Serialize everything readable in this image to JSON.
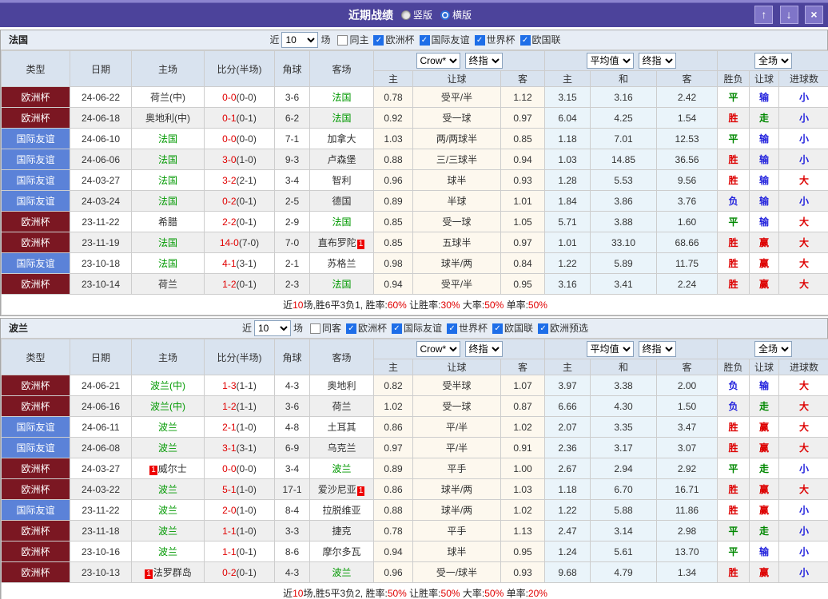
{
  "titlebar": {
    "title": "近期战绩",
    "layout_options": [
      {
        "label": "竖版",
        "selected": false
      },
      {
        "label": "横版",
        "selected": true
      }
    ],
    "buttons": {
      "up": "↑",
      "down": "↓",
      "close": "×"
    }
  },
  "table_header": {
    "type": "类型",
    "date": "日期",
    "home": "主场",
    "score": "比分(半场)",
    "corner": "角球",
    "away": "客场",
    "crow_select": "Crow*",
    "crow_index_select": "终指",
    "avg_select": "平均值",
    "avg_index_select": "终指",
    "scope_select": "全场",
    "odds_home": "主",
    "odds_handicap": "让球",
    "odds_away": "客",
    "avg_home": "主",
    "avg_draw": "和",
    "avg_away": "客",
    "result_wl": "胜负",
    "result_handicap": "让球",
    "result_goals": "进球数"
  },
  "colors": {
    "titlebar": "#4c439b",
    "euro_cup_bg": "#7b1722",
    "friendly_bg": "#5b82d8",
    "win_red": "#dd0000",
    "draw_green": "#008800",
    "lose_blue": "#2323dd",
    "team_green": "#009900",
    "score_red": "#e00000"
  },
  "sections": [
    {
      "team": "法国",
      "filter": {
        "near": "近",
        "count": "10",
        "games": "场",
        "same": {
          "label": "同主",
          "checked": false
        },
        "leagues": [
          {
            "label": "欧洲杯",
            "checked": true
          },
          {
            "label": "国际友谊",
            "checked": true
          },
          {
            "label": "世界杯",
            "checked": true
          },
          {
            "label": "欧国联",
            "checked": true
          }
        ]
      },
      "rows": [
        {
          "type": "欧洲杯",
          "date": "24-06-22",
          "home": "荷兰(中)",
          "hg": false,
          "hb": "",
          "score": "0-0",
          "half": "(0-0)",
          "corner": "3-6",
          "away": "法国",
          "ag": true,
          "ab": "",
          "o1": "0.78",
          "line": "受平/半",
          "o2": "1.12",
          "m1": "3.15",
          "m2": "3.16",
          "m3": "2.42",
          "r1": "平",
          "r2": "输",
          "r3": "小"
        },
        {
          "type": "欧洲杯",
          "date": "24-06-18",
          "home": "奥地利(中)",
          "hg": false,
          "hb": "",
          "score": "0-1",
          "half": "(0-1)",
          "corner": "6-2",
          "away": "法国",
          "ag": true,
          "ab": "",
          "o1": "0.92",
          "line": "受一球",
          "o2": "0.97",
          "m1": "6.04",
          "m2": "4.25",
          "m3": "1.54",
          "r1": "胜",
          "r2": "走",
          "r3": "小"
        },
        {
          "type": "国际友谊",
          "date": "24-06-10",
          "home": "法国",
          "hg": true,
          "hb": "",
          "score": "0-0",
          "half": "(0-0)",
          "corner": "7-1",
          "away": "加拿大",
          "ag": false,
          "ab": "",
          "o1": "1.03",
          "line": "两/两球半",
          "o2": "0.85",
          "m1": "1.18",
          "m2": "7.01",
          "m3": "12.53",
          "r1": "平",
          "r2": "输",
          "r3": "小"
        },
        {
          "type": "国际友谊",
          "date": "24-06-06",
          "home": "法国",
          "hg": true,
          "hb": "",
          "score": "3-0",
          "half": "(1-0)",
          "corner": "9-3",
          "away": "卢森堡",
          "ag": false,
          "ab": "",
          "o1": "0.88",
          "line": "三/三球半",
          "o2": "0.94",
          "m1": "1.03",
          "m2": "14.85",
          "m3": "36.56",
          "r1": "胜",
          "r2": "输",
          "r3": "小"
        },
        {
          "type": "国际友谊",
          "date": "24-03-27",
          "home": "法国",
          "hg": true,
          "hb": "",
          "score": "3-2",
          "half": "(2-1)",
          "corner": "3-4",
          "away": "智利",
          "ag": false,
          "ab": "",
          "o1": "0.96",
          "line": "球半",
          "o2": "0.93",
          "m1": "1.28",
          "m2": "5.53",
          "m3": "9.56",
          "r1": "胜",
          "r2": "输",
          "r3": "大"
        },
        {
          "type": "国际友谊",
          "date": "24-03-24",
          "home": "法国",
          "hg": true,
          "hb": "",
          "score": "0-2",
          "half": "(0-1)",
          "corner": "2-5",
          "away": "德国",
          "ag": false,
          "ab": "",
          "o1": "0.89",
          "line": "半球",
          "o2": "1.01",
          "m1": "1.84",
          "m2": "3.86",
          "m3": "3.76",
          "r1": "负",
          "r2": "输",
          "r3": "小"
        },
        {
          "type": "欧洲杯",
          "date": "23-11-22",
          "home": "希腊",
          "hg": false,
          "hb": "",
          "score": "2-2",
          "half": "(0-1)",
          "corner": "2-9",
          "away": "法国",
          "ag": true,
          "ab": "",
          "o1": "0.85",
          "line": "受一球",
          "o2": "1.05",
          "m1": "5.71",
          "m2": "3.88",
          "m3": "1.60",
          "r1": "平",
          "r2": "输",
          "r3": "大"
        },
        {
          "type": "欧洲杯",
          "date": "23-11-19",
          "home": "法国",
          "hg": true,
          "hb": "",
          "score": "14-0",
          "half": "(7-0)",
          "corner": "7-0",
          "away": "直布罗陀",
          "ag": false,
          "ab": "1",
          "o1": "0.85",
          "line": "五球半",
          "o2": "0.97",
          "m1": "1.01",
          "m2": "33.10",
          "m3": "68.66",
          "r1": "胜",
          "r2": "赢",
          "r3": "大"
        },
        {
          "type": "国际友谊",
          "date": "23-10-18",
          "home": "法国",
          "hg": true,
          "hb": "",
          "score": "4-1",
          "half": "(3-1)",
          "corner": "2-1",
          "away": "苏格兰",
          "ag": false,
          "ab": "",
          "o1": "0.98",
          "line": "球半/两",
          "o2": "0.84",
          "m1": "1.22",
          "m2": "5.89",
          "m3": "11.75",
          "r1": "胜",
          "r2": "赢",
          "r3": "大"
        },
        {
          "type": "欧洲杯",
          "date": "23-10-14",
          "home": "荷兰",
          "hg": false,
          "hb": "",
          "score": "1-2",
          "half": "(0-1)",
          "corner": "2-3",
          "away": "法国",
          "ag": true,
          "ab": "",
          "o1": "0.94",
          "line": "受平/半",
          "o2": "0.95",
          "m1": "3.16",
          "m2": "3.41",
          "m3": "2.24",
          "r1": "胜",
          "r2": "赢",
          "r3": "大"
        }
      ],
      "summary": [
        [
          "近",
          "k"
        ],
        [
          "10",
          "r"
        ],
        [
          "场,胜6平3负1, 胜率:",
          "k"
        ],
        [
          "60%",
          "r"
        ],
        [
          " 让胜率:",
          "k"
        ],
        [
          "30%",
          "r"
        ],
        [
          " 大率:",
          "k"
        ],
        [
          "50%",
          "r"
        ],
        [
          " 单率:",
          "k"
        ],
        [
          "50%",
          "r"
        ]
      ]
    },
    {
      "team": "波兰",
      "filter": {
        "near": "近",
        "count": "10",
        "games": "场",
        "same": {
          "label": "同客",
          "checked": false
        },
        "leagues": [
          {
            "label": "欧洲杯",
            "checked": true
          },
          {
            "label": "国际友谊",
            "checked": true
          },
          {
            "label": "世界杯",
            "checked": true
          },
          {
            "label": "欧国联",
            "checked": true
          },
          {
            "label": "欧洲预选",
            "checked": true
          }
        ]
      },
      "rows": [
        {
          "type": "欧洲杯",
          "date": "24-06-21",
          "home": "波兰(中)",
          "hg": true,
          "hb": "",
          "score": "1-3",
          "half": "(1-1)",
          "corner": "4-3",
          "away": "奥地利",
          "ag": false,
          "ab": "",
          "o1": "0.82",
          "line": "受半球",
          "o2": "1.07",
          "m1": "3.97",
          "m2": "3.38",
          "m3": "2.00",
          "r1": "负",
          "r2": "输",
          "r3": "大"
        },
        {
          "type": "欧洲杯",
          "date": "24-06-16",
          "home": "波兰(中)",
          "hg": true,
          "hb": "",
          "score": "1-2",
          "half": "(1-1)",
          "corner": "3-6",
          "away": "荷兰",
          "ag": false,
          "ab": "",
          "o1": "1.02",
          "line": "受一球",
          "o2": "0.87",
          "m1": "6.66",
          "m2": "4.30",
          "m3": "1.50",
          "r1": "负",
          "r2": "走",
          "r3": "大"
        },
        {
          "type": "国际友谊",
          "date": "24-06-11",
          "home": "波兰",
          "hg": true,
          "hb": "",
          "score": "2-1",
          "half": "(1-0)",
          "corner": "4-8",
          "away": "土耳其",
          "ag": false,
          "ab": "",
          "o1": "0.86",
          "line": "平/半",
          "o2": "1.02",
          "m1": "2.07",
          "m2": "3.35",
          "m3": "3.47",
          "r1": "胜",
          "r2": "赢",
          "r3": "大"
        },
        {
          "type": "国际友谊",
          "date": "24-06-08",
          "home": "波兰",
          "hg": true,
          "hb": "",
          "score": "3-1",
          "half": "(3-1)",
          "corner": "6-9",
          "away": "乌克兰",
          "ag": false,
          "ab": "",
          "o1": "0.97",
          "line": "平/半",
          "o2": "0.91",
          "m1": "2.36",
          "m2": "3.17",
          "m3": "3.07",
          "r1": "胜",
          "r2": "赢",
          "r3": "大"
        },
        {
          "type": "欧洲杯",
          "date": "24-03-27",
          "home": "威尔士",
          "hg": false,
          "hb": "1",
          "score": "0-0",
          "half": "(0-0)",
          "corner": "3-4",
          "away": "波兰",
          "ag": true,
          "ab": "",
          "o1": "0.89",
          "line": "平手",
          "o2": "1.00",
          "m1": "2.67",
          "m2": "2.94",
          "m3": "2.92",
          "r1": "平",
          "r2": "走",
          "r3": "小"
        },
        {
          "type": "欧洲杯",
          "date": "24-03-22",
          "home": "波兰",
          "hg": true,
          "hb": "",
          "score": "5-1",
          "half": "(1-0)",
          "corner": "17-1",
          "away": "爱沙尼亚",
          "ag": false,
          "ab": "1",
          "o1": "0.86",
          "line": "球半/两",
          "o2": "1.03",
          "m1": "1.18",
          "m2": "6.70",
          "m3": "16.71",
          "r1": "胜",
          "r2": "赢",
          "r3": "大"
        },
        {
          "type": "国际友谊",
          "date": "23-11-22",
          "home": "波兰",
          "hg": true,
          "hb": "",
          "score": "2-0",
          "half": "(1-0)",
          "corner": "8-4",
          "away": "拉脱维亚",
          "ag": false,
          "ab": "",
          "o1": "0.88",
          "line": "球半/两",
          "o2": "1.02",
          "m1": "1.22",
          "m2": "5.88",
          "m3": "11.86",
          "r1": "胜",
          "r2": "赢",
          "r3": "小"
        },
        {
          "type": "欧洲杯",
          "date": "23-11-18",
          "home": "波兰",
          "hg": true,
          "hb": "",
          "score": "1-1",
          "half": "(1-0)",
          "corner": "3-3",
          "away": "捷克",
          "ag": false,
          "ab": "",
          "o1": "0.78",
          "line": "平手",
          "o2": "1.13",
          "m1": "2.47",
          "m2": "3.14",
          "m3": "2.98",
          "r1": "平",
          "r2": "走",
          "r3": "小"
        },
        {
          "type": "欧洲杯",
          "date": "23-10-16",
          "home": "波兰",
          "hg": true,
          "hb": "",
          "score": "1-1",
          "half": "(0-1)",
          "corner": "8-6",
          "away": "摩尔多瓦",
          "ag": false,
          "ab": "",
          "o1": "0.94",
          "line": "球半",
          "o2": "0.95",
          "m1": "1.24",
          "m2": "5.61",
          "m3": "13.70",
          "r1": "平",
          "r2": "输",
          "r3": "小"
        },
        {
          "type": "欧洲杯",
          "date": "23-10-13",
          "home": "法罗群岛",
          "hg": false,
          "hb": "1",
          "score": "0-2",
          "half": "(0-1)",
          "corner": "4-3",
          "away": "波兰",
          "ag": true,
          "ab": "",
          "o1": "0.96",
          "line": "受一/球半",
          "o2": "0.93",
          "m1": "9.68",
          "m2": "4.79",
          "m3": "1.34",
          "r1": "胜",
          "r2": "赢",
          "r3": "小"
        }
      ],
      "summary": [
        [
          "近",
          "k"
        ],
        [
          "10",
          "r"
        ],
        [
          "场,胜5平3负2, 胜率:",
          "k"
        ],
        [
          "50%",
          "r"
        ],
        [
          " 让胜率:",
          "k"
        ],
        [
          "50%",
          "r"
        ],
        [
          " 大率:",
          "k"
        ],
        [
          "50%",
          "r"
        ],
        [
          " 单率:",
          "k"
        ],
        [
          "20%",
          "r"
        ]
      ]
    }
  ]
}
